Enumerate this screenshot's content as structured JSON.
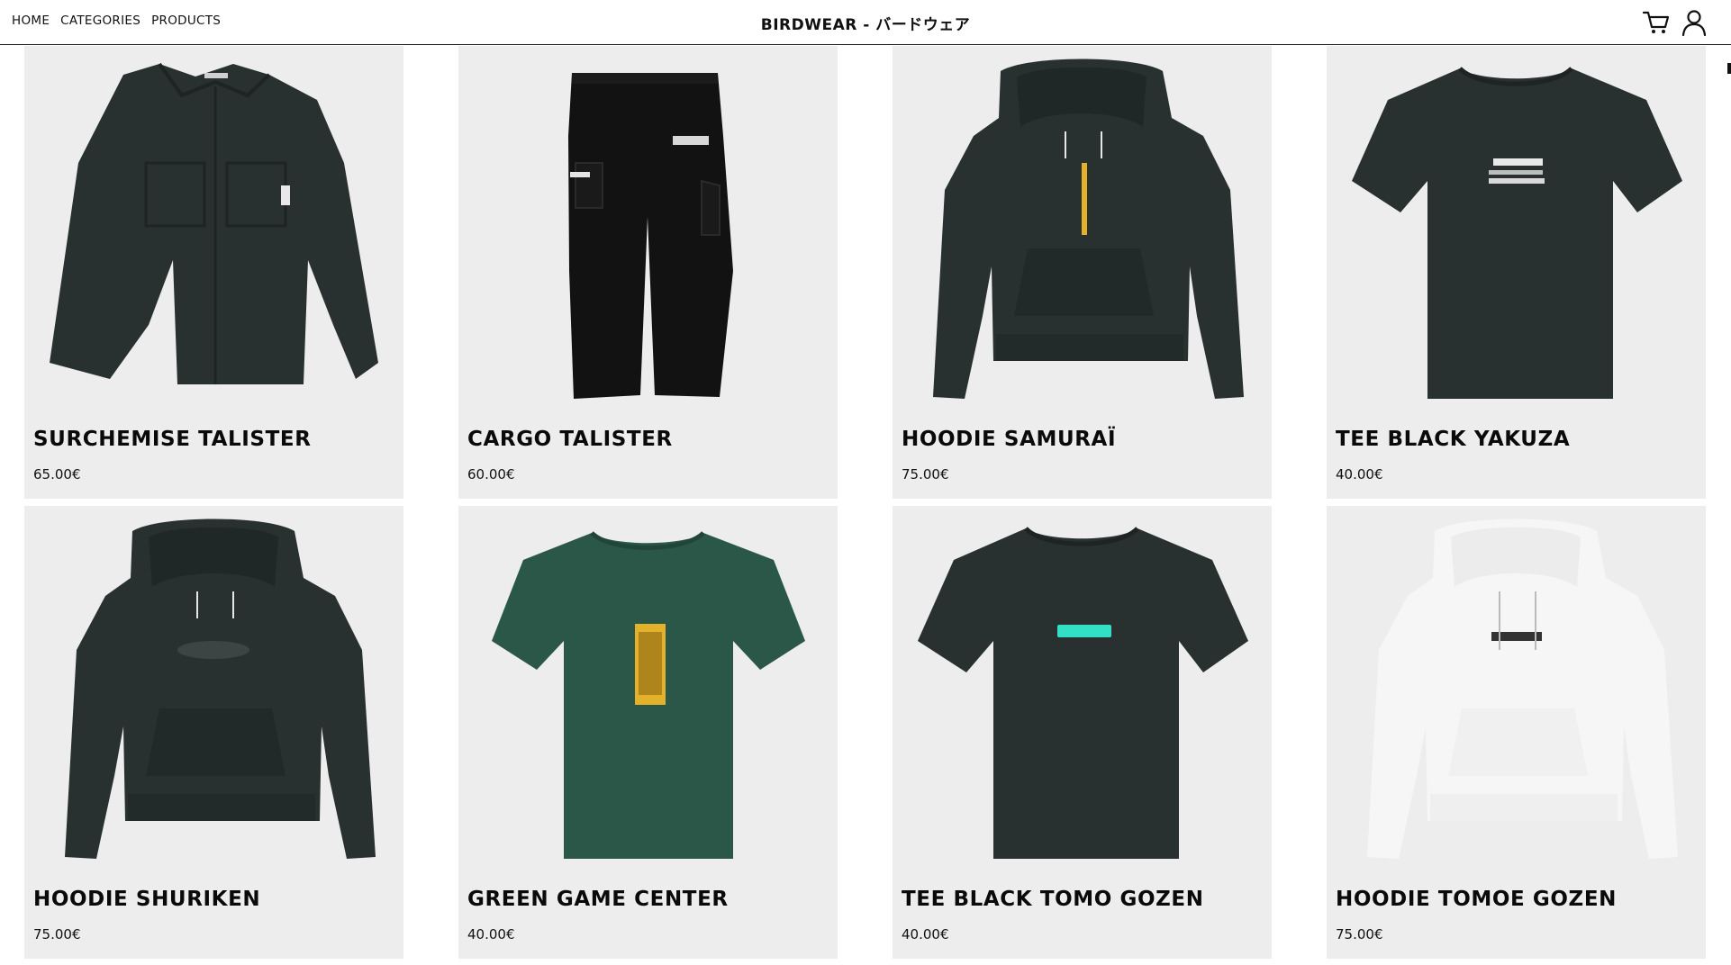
{
  "nav": {
    "items": [
      {
        "label": "HOME"
      },
      {
        "label": "CATEGORIES"
      },
      {
        "label": "PRODUCTS"
      }
    ]
  },
  "brand": {
    "title": "BIRDWEAR - バードウェア"
  },
  "header_icons": [
    "cart-icon",
    "user-icon"
  ],
  "colors": {
    "card_bg": "#ededed",
    "garment_dark": "#283130",
    "garment_green": "#2a5748",
    "garment_white": "#f6f6f6",
    "accent_yellow": "#e3b12a",
    "accent_teal": "#33e0c6"
  },
  "products": [
    {
      "name": "SURCHEMISE TALISTER",
      "price": "65.00€",
      "kind": "overshirt-icon"
    },
    {
      "name": "CARGO TALISTER",
      "price": "60.00€",
      "kind": "cargo-pants-icon"
    },
    {
      "name": "HOODIE SAMURAÏ",
      "price": "75.00€",
      "kind": "hoodie-icon"
    },
    {
      "name": "TEE BLACK YAKUZA",
      "price": "40.00€",
      "kind": "tshirt-icon"
    },
    {
      "name": "HOODIE SHURIKEN",
      "price": "75.00€",
      "kind": "hoodie-icon"
    },
    {
      "name": "GREEN GAME CENTER",
      "price": "40.00€",
      "kind": "tshirt-icon"
    },
    {
      "name": "TEE BLACK TOMO GOZEN",
      "price": "40.00€",
      "kind": "tshirt-icon"
    },
    {
      "name": "HOODIE TOMOE GOZEN",
      "price": "75.00€",
      "kind": "hoodie-icon"
    }
  ]
}
